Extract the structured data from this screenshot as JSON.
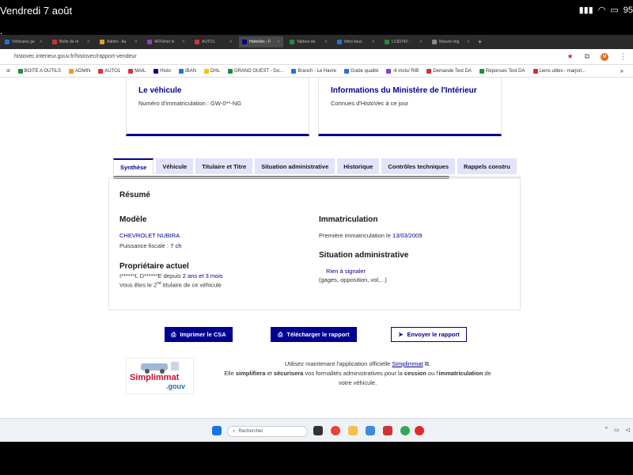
{
  "ios_status": {
    "time": "Vendredi 7 août",
    "battery": "95"
  },
  "viewer": {
    "filename": "image.png"
  },
  "browser": {
    "tabs": [
      {
        "label": "Véhicules gu",
        "color": "#2a6fd6",
        "active": false
      },
      {
        "label": "Boîte de ré",
        "color": "#c33",
        "active": false
      },
      {
        "label": "Admin - Au",
        "color": "#e0a020",
        "active": false
      },
      {
        "label": "AFFicher le",
        "color": "#8a3fc9",
        "active": false
      },
      {
        "label": "AUTO1",
        "color": "#d33",
        "active": false
      },
      {
        "label": "HistoVec - F",
        "color": "#000091",
        "active": true
      },
      {
        "label": "Tableur de",
        "color": "#1e8e3e",
        "active": false
      },
      {
        "label": "Infos lieux",
        "color": "#2a6fd6",
        "active": false
      },
      {
        "label": "LC83742 -",
        "color": "#1e8e3e",
        "active": false
      },
      {
        "label": "Nouvel ong",
        "color": "#888",
        "active": false
      }
    ],
    "url": "histovec.interieur.gouv.fr/histovec/rapport-vendeur",
    "avatar_letter": "M",
    "bookmarks": [
      {
        "label": "st",
        "color": "#fff"
      },
      {
        "label": "BOITE A OUTILS",
        "color": "#1e8e3e"
      },
      {
        "label": "ADMIN",
        "color": "#e0a020"
      },
      {
        "label": "AUTO1",
        "color": "#d33"
      },
      {
        "label": "MAIL",
        "color": "#c33"
      },
      {
        "label": "Histo",
        "color": "#000091"
      },
      {
        "label": "IBAN",
        "color": "#2a6fd6"
      },
      {
        "label": "DHL",
        "color": "#f5c400"
      },
      {
        "label": "GRAND OUEST - Go...",
        "color": "#1e8e3e"
      },
      {
        "label": "Branch - Le Havre",
        "color": "#2a6fd6"
      },
      {
        "label": "Guide qualité",
        "color": "#2a6fd6"
      },
      {
        "label": "-6 mois/ RIB",
        "color": "#8a3fc9"
      },
      {
        "label": "Demande Test DA",
        "color": "#c33"
      },
      {
        "label": "Réponses Test DA",
        "color": "#1e8e3e"
      },
      {
        "label": "Liens utiles - marjori...",
        "color": "#c33"
      }
    ]
  },
  "cards": {
    "vehicle_title": "Le véhicule",
    "vehicle_plate": "Numéro d'immatriculation : GW-0**-NG",
    "ministry_title": "Informations du Ministère de l'Intérieur",
    "ministry_text": "Connues d'HistoVec à ce jour"
  },
  "report_tabs": [
    "Synthèse",
    "Véhicule",
    "Titulaire et Titre",
    "Situation administrative",
    "Historique",
    "Contrôles techniques",
    "Rappels constru"
  ],
  "summary": {
    "title": "Résumé",
    "model_heading": "Modèle",
    "model_name": "CHEVROLET NUBIRA",
    "power_label": "Puissance fiscale : ",
    "power_value": "7 ch",
    "owner_heading": "Propriétaire actuel",
    "owner_name": "I******L D******E",
    "owner_since_label": " depuis ",
    "owner_since_value": "2 ans et 3 mois",
    "owner_rank_pre": "Vous êtes le ",
    "owner_rank_num": "2",
    "owner_rank_sup": "nd",
    "owner_rank_post": " titulaire de ce véhicule",
    "immat_heading": "Immatriculation",
    "first_immat_label": "Première immatriculation le ",
    "first_immat_date": "13/03/2009",
    "admin_heading": "Situation administrative",
    "admin_status": "Rien à signaler",
    "admin_detail": "(gages, opposition, vol,...)"
  },
  "actions": {
    "print": "Imprimer le CSA",
    "download": "Télécharger le rapport",
    "send": "Envoyer le rapport"
  },
  "simplimmat": {
    "logo_name": "Simplimmat",
    "logo_gouv": ".gouv",
    "line1_pre": "Utilisez maintenant l'application officielle ",
    "line1_link": "Simplimmat",
    "line1_post": ".",
    "line2_a": "Elle ",
    "line2_b": "simplifiera",
    "line2_c": " et ",
    "line2_d": "sécurisera",
    "line2_e": " vos formalités administratives pour la ",
    "line2_f": "cession",
    "line2_g": " ou l'",
    "line2_h": "immatriculation",
    "line2_i": " de",
    "line3": "votre véhicule."
  },
  "taskbar": {
    "search_placeholder": "Rechercher"
  }
}
